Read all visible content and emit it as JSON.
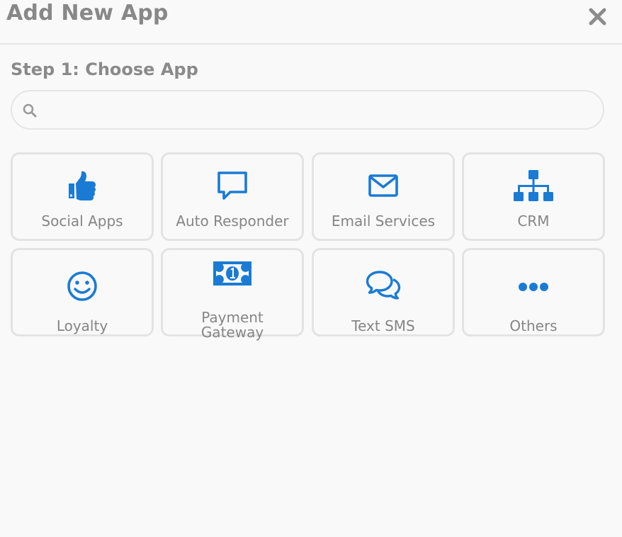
{
  "modal": {
    "title": "Add New App",
    "close_icon": "close-icon"
  },
  "step": {
    "title": "Step 1: Choose App"
  },
  "search": {
    "placeholder": "",
    "value": "",
    "icon": "search-icon"
  },
  "colors": {
    "accent": "#1a7bd4",
    "title_text": "#888888",
    "label_text": "#858585",
    "tile_border": "#e3e3e3",
    "background": "#f9f9f9"
  },
  "apps": [
    {
      "label": "Social Apps",
      "icon": "thumbs-up-icon"
    },
    {
      "label": "Auto Responder",
      "icon": "speech-bubble-icon"
    },
    {
      "label": "Email Services",
      "icon": "envelope-icon"
    },
    {
      "label": "CRM",
      "icon": "sitemap-icon"
    },
    {
      "label": "Loyalty",
      "icon": "smiley-icon"
    },
    {
      "label_line1": "Payment",
      "label_line2": "Gateway",
      "icon": "money-bill-icon"
    },
    {
      "label": "Text SMS",
      "icon": "chat-bubbles-icon"
    },
    {
      "label": "Others",
      "icon": "ellipsis-icon"
    }
  ]
}
